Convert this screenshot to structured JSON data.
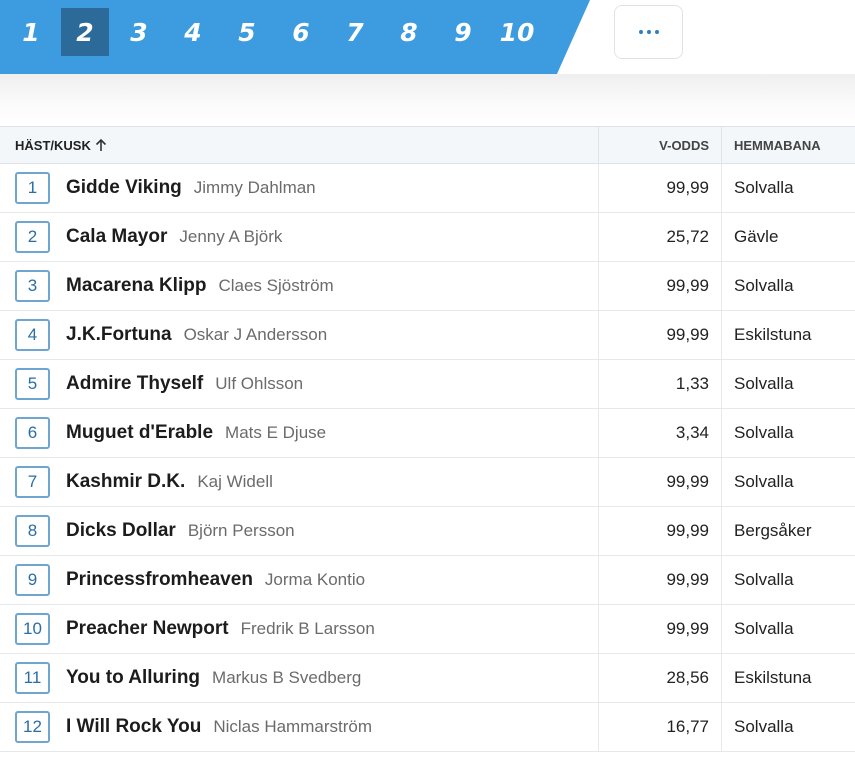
{
  "race_tabs": [
    {
      "label": "1",
      "active": false
    },
    {
      "label": "2",
      "active": true
    },
    {
      "label": "3",
      "active": false
    },
    {
      "label": "4",
      "active": false
    },
    {
      "label": "5",
      "active": false
    },
    {
      "label": "6",
      "active": false
    },
    {
      "label": "7",
      "active": false
    },
    {
      "label": "8",
      "active": false
    },
    {
      "label": "9",
      "active": false
    },
    {
      "label": "10",
      "active": false
    }
  ],
  "more_icon": "more-dots-icon",
  "colors": {
    "accent": "#3d9be0",
    "active_tab": "#2b6a99",
    "number_border": "#6fa6cf",
    "number_text": "#2a6ea6"
  },
  "table": {
    "headers": {
      "horse_driver": "HÄST/KUSK",
      "v_odds": "V-ODDS",
      "home_track": "HEMMABANA"
    },
    "sort_icon": "arrow-up-icon",
    "rows": [
      {
        "number": "1",
        "horse": "Gidde Viking",
        "driver": "Jimmy Dahlman",
        "odds": "99,99",
        "home": "Solvalla"
      },
      {
        "number": "2",
        "horse": "Cala Mayor",
        "driver": "Jenny A Björk",
        "odds": "25,72",
        "home": "Gävle"
      },
      {
        "number": "3",
        "horse": "Macarena Klipp",
        "driver": "Claes Sjöström",
        "odds": "99,99",
        "home": "Solvalla"
      },
      {
        "number": "4",
        "horse": "J.K.Fortuna",
        "driver": "Oskar J Andersson",
        "odds": "99,99",
        "home": "Eskilstuna"
      },
      {
        "number": "5",
        "horse": "Admire Thyself",
        "driver": "Ulf Ohlsson",
        "odds": "1,33",
        "home": "Solvalla"
      },
      {
        "number": "6",
        "horse": "Muguet d'Erable",
        "driver": "Mats E Djuse",
        "odds": "3,34",
        "home": "Solvalla"
      },
      {
        "number": "7",
        "horse": "Kashmir D.K.",
        "driver": "Kaj Widell",
        "odds": "99,99",
        "home": "Solvalla"
      },
      {
        "number": "8",
        "horse": "Dicks Dollar",
        "driver": "Björn Persson",
        "odds": "99,99",
        "home": "Bergsåker"
      },
      {
        "number": "9",
        "horse": "Princessfromheaven",
        "driver": "Jorma Kontio",
        "odds": "99,99",
        "home": "Solvalla"
      },
      {
        "number": "10",
        "horse": "Preacher Newport",
        "driver": "Fredrik B Larsson",
        "odds": "99,99",
        "home": "Solvalla"
      },
      {
        "number": "11",
        "horse": "You to Alluring",
        "driver": "Markus B Svedberg",
        "odds": "28,56",
        "home": "Eskilstuna"
      },
      {
        "number": "12",
        "horse": "I Will Rock You",
        "driver": "Niclas Hammarström",
        "odds": "16,77",
        "home": "Solvalla"
      }
    ]
  }
}
